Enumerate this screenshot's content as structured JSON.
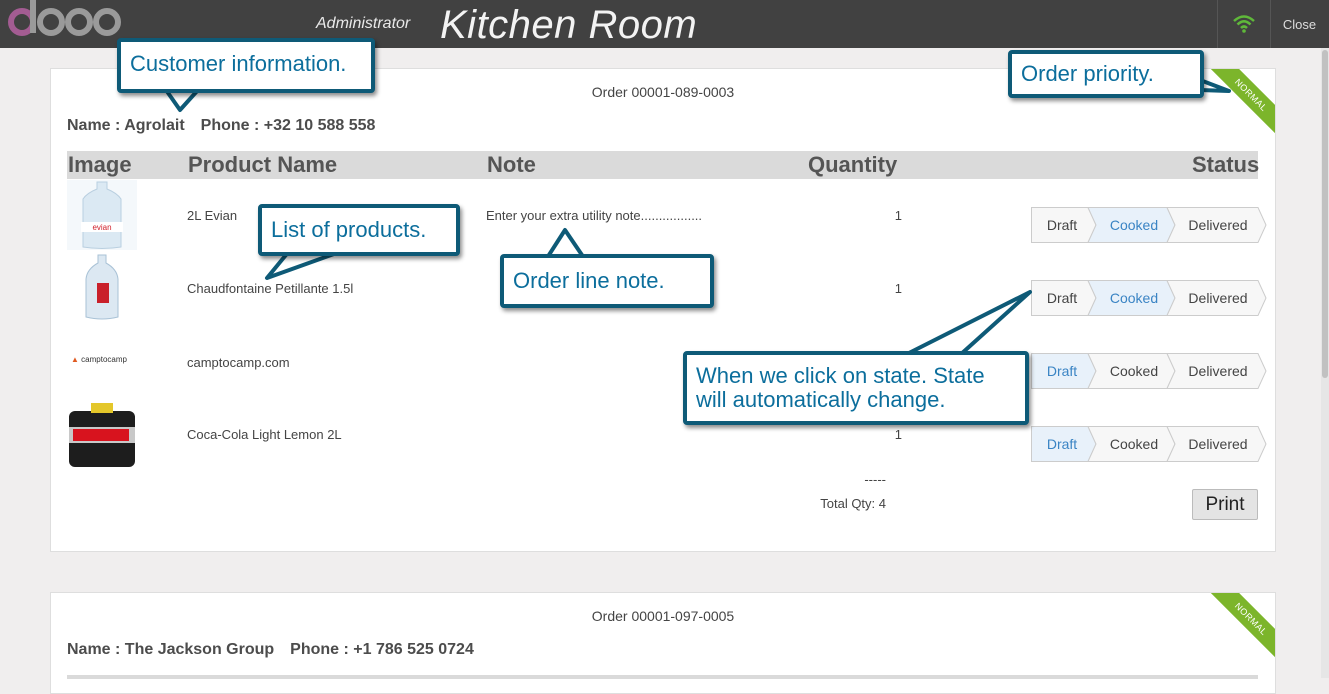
{
  "header": {
    "user": "Administrator",
    "title": "Kitchen Room",
    "close_label": "Close"
  },
  "colors": {
    "accent": "#0c6e9c",
    "ribbon": "#7cb52b",
    "callout_border": "#0e5a77",
    "logo": "#a0a0a0"
  },
  "orders": [
    {
      "order_no": "Order 00001-089-0003",
      "name_label": "Name : Agrolait",
      "phone_label": "Phone : +32 10 588 558",
      "priority": "NORMAL",
      "columns": {
        "image": "Image",
        "product": "Product Name",
        "note": "Note",
        "quantity": "Quantity",
        "status": "Status"
      },
      "lines": [
        {
          "product": "2L Evian",
          "note": "Enter your extra utility note.................",
          "qty": "1",
          "active_state": "Cooked",
          "image_icon": "water-bottle-evian"
        },
        {
          "product": "Chaudfontaine Petillante 1.5l",
          "note": "",
          "qty": "1",
          "active_state": "Cooked",
          "image_icon": "water-bottle-chaudfontaine"
        },
        {
          "product": "camptocamp.com",
          "note": "",
          "qty": "",
          "active_state": "Draft",
          "image_icon": "camptocamp-logo",
          "image_text": "camptocamp"
        },
        {
          "product": "Coca-Cola Light Lemon 2L",
          "note": "",
          "qty": "1",
          "active_state": "Draft",
          "image_icon": "coca-cola-bottles"
        }
      ],
      "states": [
        "Draft",
        "Cooked",
        "Delivered"
      ],
      "separator": "-----",
      "total": "Total Qty: 4",
      "print_label": "Print"
    },
    {
      "order_no": "Order 00001-097-0005",
      "name_label": "Name : The Jackson Group",
      "phone_label": "Phone : +1 786 525 0724",
      "priority": "NORMAL"
    }
  ],
  "callouts": {
    "customer": "Customer information.",
    "priority": "Order priority.",
    "products": "List of products.",
    "note": "Order line note.",
    "state_line1": "When we click on state. State",
    "state_line2": "will automatically change."
  }
}
